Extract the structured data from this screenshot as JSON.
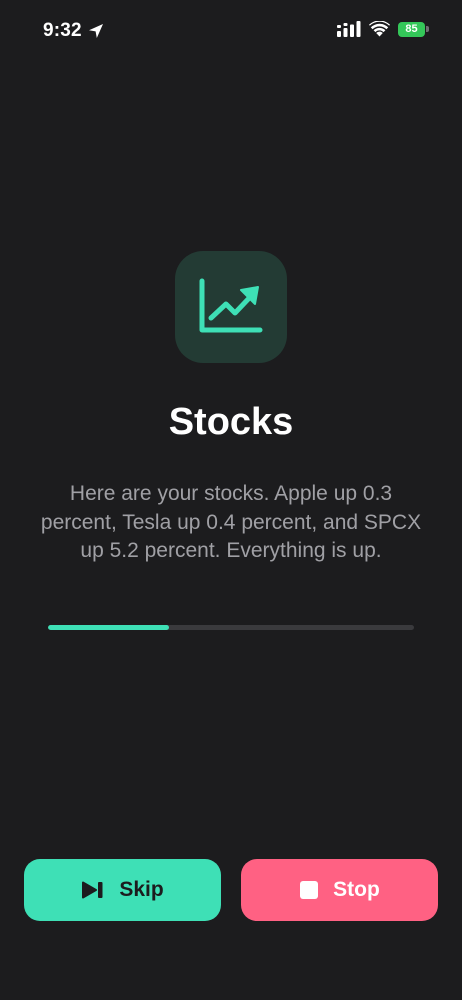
{
  "status_bar": {
    "time": "9:32",
    "battery": "85"
  },
  "app": {
    "icon": "stock-chart-icon",
    "title": "Stocks",
    "message": "Here are your stocks. Apple up 0.3 percent, Tesla up 0.4 percent, and SPCX up 5.2 percent. Everything is up."
  },
  "progress": {
    "fraction": 0.33
  },
  "actions": {
    "skip_label": "Skip",
    "stop_label": "Stop"
  },
  "colors": {
    "background": "#1c1c1e",
    "accent": "#3ee0b6",
    "stop": "#ff6183",
    "battery": "#34c759"
  }
}
